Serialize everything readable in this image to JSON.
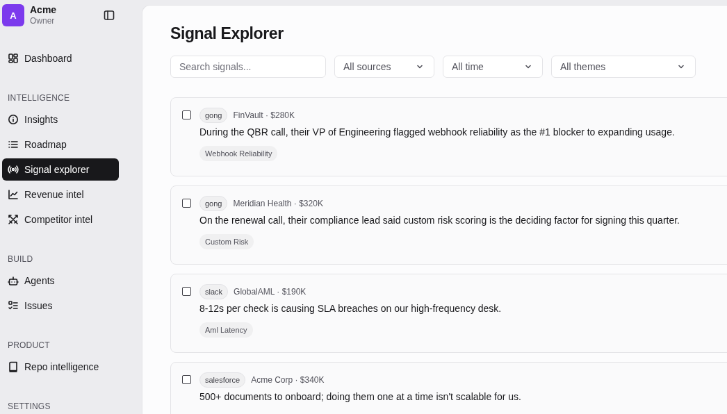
{
  "workspace": {
    "avatar": "A",
    "name": "Acme",
    "role": "Owner"
  },
  "sidebar": {
    "sections": [
      {
        "items": [
          {
            "label": "Dashboard",
            "selected": false
          }
        ]
      },
      {
        "heading": "INTELLIGENCE",
        "items": [
          {
            "label": "Insights",
            "selected": false
          },
          {
            "label": "Roadmap",
            "selected": false
          },
          {
            "label": "Signal explorer",
            "selected": true
          },
          {
            "label": "Revenue intel",
            "selected": false
          },
          {
            "label": "Competitor intel",
            "selected": false
          }
        ]
      },
      {
        "heading": "BUILD",
        "items": [
          {
            "label": "Agents",
            "selected": false
          },
          {
            "label": "Issues",
            "selected": false
          }
        ]
      },
      {
        "heading": "PRODUCT",
        "items": [
          {
            "label": "Repo intelligence",
            "selected": false
          }
        ]
      },
      {
        "heading": "SETTINGS"
      }
    ]
  },
  "page": {
    "title": "Signal Explorer"
  },
  "filters": {
    "search": {
      "placeholder": "Search signals..."
    },
    "dropdowns": [
      {
        "value": "All sources"
      },
      {
        "value": "All time"
      },
      {
        "value": "All themes"
      }
    ]
  },
  "signals": [
    {
      "checked": false,
      "source": "gong",
      "account": "FinVault · $280K",
      "text": "During the QBR call, their VP of Engineering flagged webhook reliability as the #1 blocker to expanding usage.",
      "theme": "Webhook Reliability"
    },
    {
      "checked": false,
      "source": "gong",
      "account": "Meridian Health · $320K",
      "text": "On the renewal call, their compliance lead said custom risk scoring is the deciding factor for signing this quarter.",
      "theme": "Custom Risk"
    },
    {
      "checked": false,
      "source": "slack",
      "account": "GlobalAML · $190K",
      "text": "8-12s per check is causing SLA breaches on our high-frequency desk.",
      "theme": "Aml Latency"
    },
    {
      "checked": false,
      "source": "salesforce",
      "account": "Acme Corp · $340K",
      "text": "500+ documents to onboard; doing them one at a time isn't scalable for us."
    }
  ]
}
